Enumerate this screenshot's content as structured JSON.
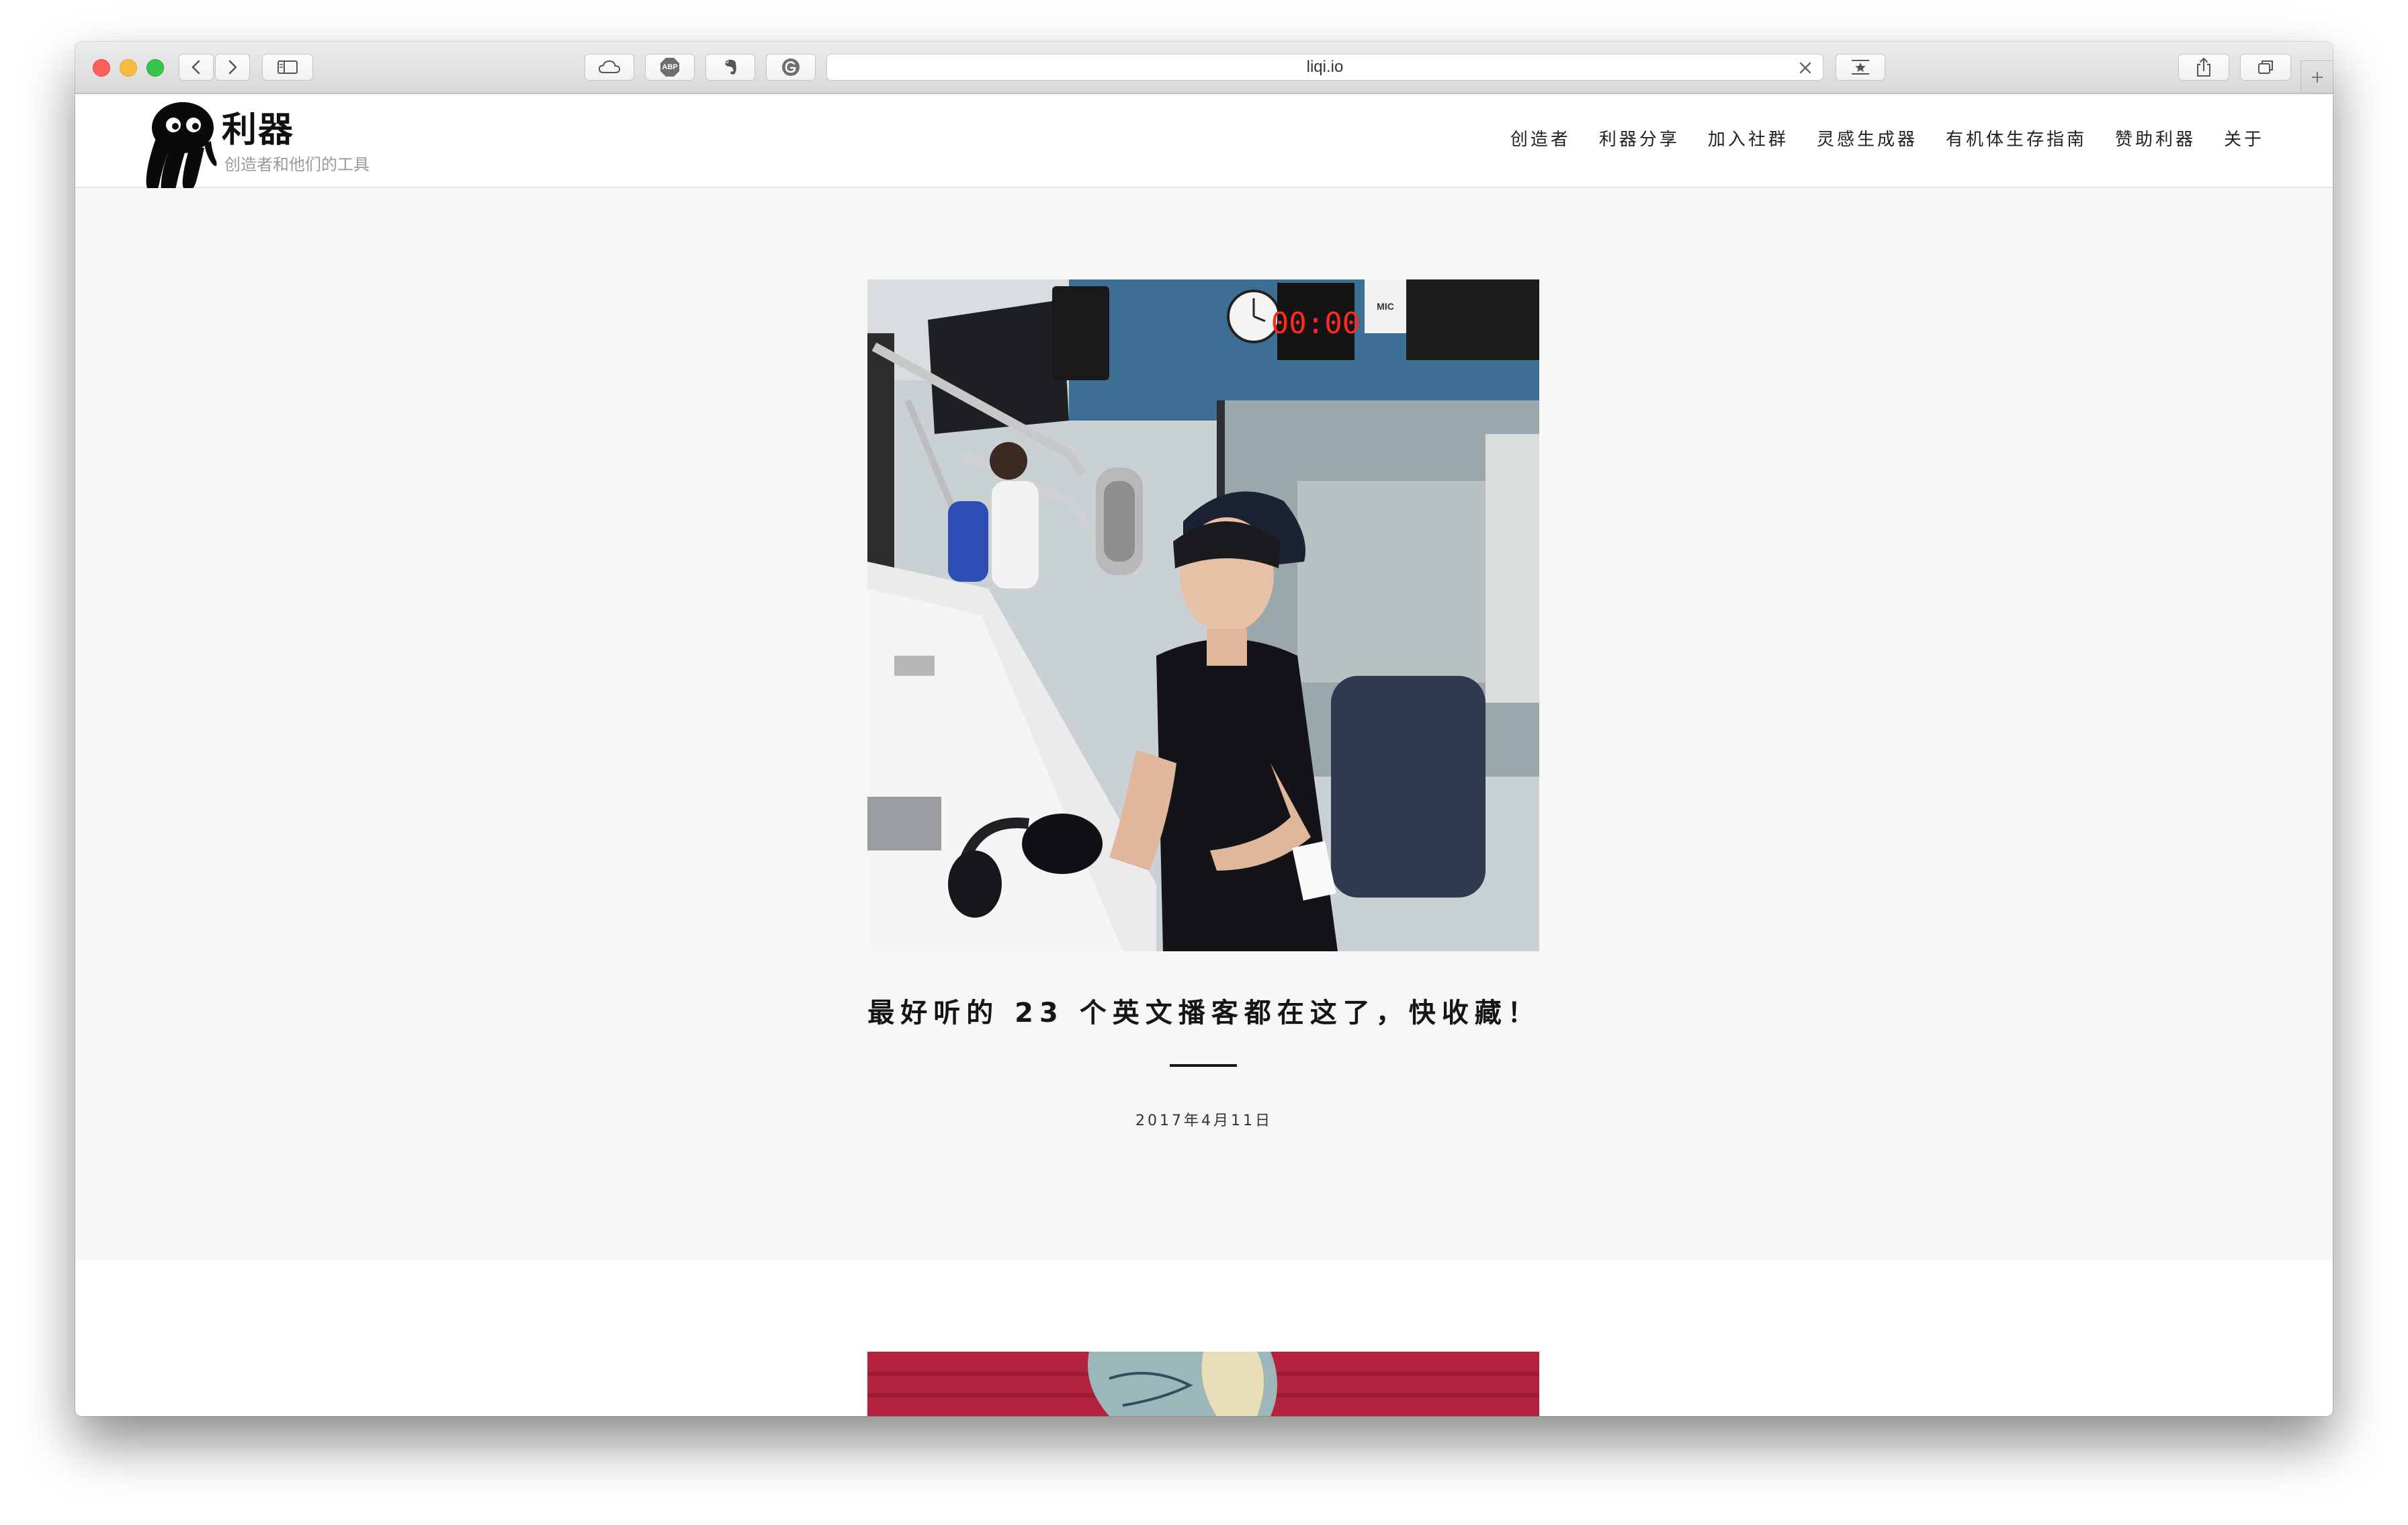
{
  "browser": {
    "url": "liqi.io",
    "icons": {
      "back": "chevron-left-icon",
      "forward": "chevron-right-icon",
      "sidebar": "sidebar-icon",
      "cloud": "icloud-tabs-icon",
      "adblock": "adblock-plus-icon",
      "evernote": "evernote-icon",
      "grammarly": "grammarly-icon",
      "clear": "close-icon",
      "reader": "bookmark-star-icon",
      "share": "share-icon",
      "tabs": "tab-overview-icon",
      "new_tab": "plus-icon"
    },
    "adblock_label": "ABP"
  },
  "site": {
    "title": "利器",
    "tagline": "创造者和他们的工具",
    "logo_icon": "octopus-logo-icon",
    "nav": [
      "创造者",
      "利器分享",
      "加入社群",
      "灵感生成器",
      "有机体生存指南",
      "赞助利器",
      "关于"
    ]
  },
  "posts": [
    {
      "title": "最好听的 23 个英文播客都在这了，快收藏！",
      "date": "2017年4月11日",
      "image_text": {
        "timer": "00:00",
        "mic_sign": "MIC"
      }
    }
  ],
  "colors": {
    "text_dark": "#151515",
    "tagline": "#9a9a9a",
    "section_bg": "#f6f6f6",
    "timer_red": "#ff2a1a"
  }
}
